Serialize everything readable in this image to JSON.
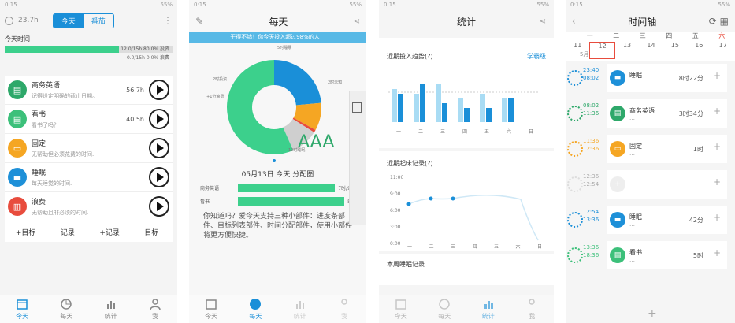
{
  "status": {
    "time": "0:15",
    "battery": "55%"
  },
  "p1": {
    "duration": "23.7h",
    "seg_today": "今天",
    "seg_tomato": "番茄",
    "today_label": "今天时间",
    "bar1_text": "12.0/15h 80.0% 投资",
    "bar1_fill_pct": 80,
    "bar2_text": "0.0/15h 0.0% 浪费",
    "items": [
      {
        "name": "商务英语",
        "desc": "记得设定明确的截止日期。",
        "val": "56.7h",
        "color": "#2ea86a",
        "icon": "book-icon"
      },
      {
        "name": "看书",
        "desc": "看书了吗？",
        "val": "40.5h",
        "color": "#3cc07a",
        "icon": "book-icon"
      },
      {
        "name": "固定",
        "desc": "无帮助但必须花费的时间.",
        "val": "",
        "color": "#f5a623",
        "icon": "monitor-icon"
      },
      {
        "name": "睡眠",
        "desc": "每天睡觉的时间.",
        "val": "",
        "color": "#1e90d8",
        "icon": "bed-icon"
      },
      {
        "name": "浪费",
        "desc": "无帮助且非必须的时间.",
        "val": "",
        "color": "#e84c3d",
        "icon": "trash-icon"
      }
    ],
    "actions": [
      "+目标",
      "记录",
      "+记录",
      "目标"
    ]
  },
  "tabs": [
    "今天",
    "每天",
    "统计",
    "我"
  ],
  "p2": {
    "title": "每天",
    "banner": "干得不错！你今天投入超过98%的人！",
    "pie_labels": [
      "5时睡眠",
      "2时投资",
      "+1分浪费",
      "2时未知",
      "12时睡眠"
    ],
    "pie_data": [
      {
        "name": "5时睡眠",
        "value": 5,
        "color": "#1a8fd8"
      },
      {
        "name": "2时投资",
        "value": 2,
        "color": "#f5a623"
      },
      {
        "name": "+1分浪费",
        "value": 0.2,
        "color": "#e84c3d"
      },
      {
        "name": "2时未知",
        "value": 2,
        "color": "#cfcfcf"
      },
      {
        "name": "12时睡眠",
        "value": 12,
        "color": "#3cd08c"
      }
    ],
    "aaa": "AAA",
    "chart_title": "05月13日 今天 分配图",
    "bars": [
      {
        "label": "商务英语",
        "val": "7时/9时"
      },
      {
        "label": "看书",
        "val": "5时"
      }
    ],
    "tip": "你知道吗？爱今天支持三种小部件：进度条部件、目标列表部件、时间分配部件，使用小部件将更方便快捷。"
  },
  "p3": {
    "title": "统计",
    "trend_title": "近期投入趋势(?)",
    "trend_link": "学霸级",
    "days": [
      "一",
      "二",
      "三",
      "四",
      "五",
      "六",
      "日"
    ],
    "wake_title": "近期起床记录(?)",
    "wake_ticks": [
      "11:00",
      "9:00",
      "6:00",
      "3:00",
      "0:00"
    ],
    "sleep_title": "本周睡眠记录"
  },
  "chart_data": {
    "type": "bar",
    "categories": [
      "一",
      "二",
      "三",
      "四",
      "五",
      "六",
      "日"
    ],
    "series": [
      {
        "values": [
          7,
          6,
          8,
          5,
          6,
          5,
          0
        ]
      },
      {
        "values": [
          6,
          8,
          4,
          3,
          3,
          5,
          0
        ]
      }
    ],
    "ylim": [
      0,
      10
    ]
  },
  "p4": {
    "title": "时间轴",
    "weekdays": [
      "一",
      "二",
      "三",
      "四",
      "五",
      "六"
    ],
    "dates": [
      "11",
      "12",
      "13",
      "14",
      "15",
      "16",
      "17"
    ],
    "month": "5月",
    "rows": [
      {
        "t1": "23:40",
        "t2": "08:02",
        "name": "睡眠",
        "dur": "8时22分",
        "color": "#1e90d8",
        "icon": "bed-icon",
        "kind": "card"
      },
      {
        "t1": "08:02",
        "t2": "11:36",
        "name": "商务英语",
        "dur": "3时34分",
        "color": "#2ea86a",
        "icon": "book-icon",
        "kind": "card"
      },
      {
        "t1": "11:36",
        "t2": "12:36",
        "name": "固定",
        "dur": "1时",
        "color": "#f5a623",
        "icon": "monitor-icon",
        "kind": "card"
      },
      {
        "t1": "12:36",
        "t2": "12:54",
        "name": "",
        "dur": "",
        "color": "#ddd",
        "icon": "plus-icon",
        "kind": "empty"
      },
      {
        "t1": "12:54",
        "t2": "13:36",
        "name": "睡眠",
        "dur": "42分",
        "color": "#1e90d8",
        "icon": "bed-icon",
        "kind": "card"
      },
      {
        "t1": "13:36",
        "t2": "18:36",
        "name": "看书",
        "dur": "5时",
        "color": "#3cc07a",
        "icon": "book-icon",
        "kind": "card"
      }
    ]
  }
}
